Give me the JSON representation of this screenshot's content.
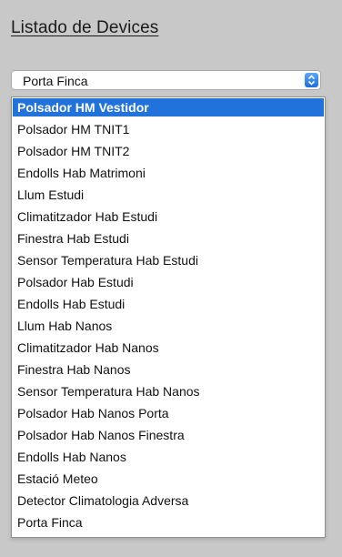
{
  "page": {
    "title": "Listado de Devices"
  },
  "select": {
    "value": "Porta Finca"
  },
  "accent": "#2272dc",
  "options": [
    "Polsador HM Vestidor",
    "Polsador HM TNIT1",
    "Polsador HM TNIT2",
    "Endolls Hab Matrimoni",
    "Llum Estudi",
    "Climatitzador Hab Estudi",
    "Finestra Hab Estudi",
    "Sensor Temperatura Hab Estudi",
    "Polsador Hab Estudi",
    "Endolls Hab Estudi",
    "Llum Hab Nanos",
    "Climatitzador Hab Nanos",
    "Finestra Hab Nanos",
    "Sensor Temperatura Hab Nanos",
    "Polsador Hab Nanos Porta",
    "Polsador Hab Nanos Finestra",
    "Endolls Hab Nanos",
    "Estació Meteo",
    "Detector Climatologia Adversa",
    "Porta Finca"
  ],
  "highlighted_option": "Polsador HM Vestidor"
}
